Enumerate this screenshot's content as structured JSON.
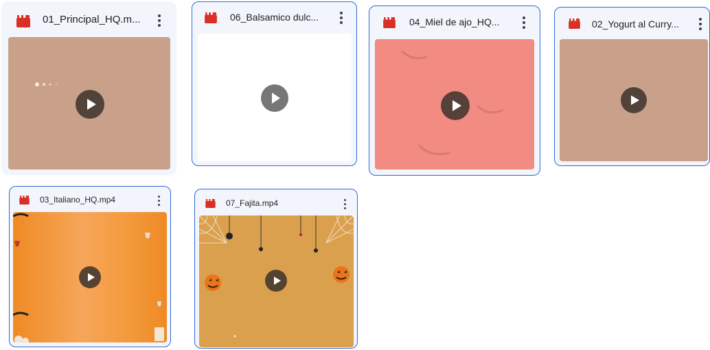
{
  "files": [
    {
      "name": "01_Principal_HQ.m...",
      "thumb_color": "#c9a089",
      "icon": "video-file-icon"
    },
    {
      "name": "06_Balsamico dulc...",
      "thumb_color": "#ffffff",
      "icon": "video-file-icon"
    },
    {
      "name": "04_Miel de ajo_HQ...",
      "thumb_color": "#f28b82",
      "icon": "video-file-icon"
    },
    {
      "name": "02_Yogurt al Curry...",
      "thumb_color": "#c9a089",
      "icon": "video-file-icon"
    },
    {
      "name": "03_Italiano_HQ.mp4",
      "thumb_color": "#f39a3c",
      "icon": "video-file-icon"
    },
    {
      "name": "07_Fajita.mp4",
      "thumb_color": "#dba04e",
      "icon": "video-file-icon"
    }
  ],
  "colors": {
    "selection_border": "#2f68d6",
    "card_background": "#f2f5fc",
    "video_icon": "#d93025"
  }
}
